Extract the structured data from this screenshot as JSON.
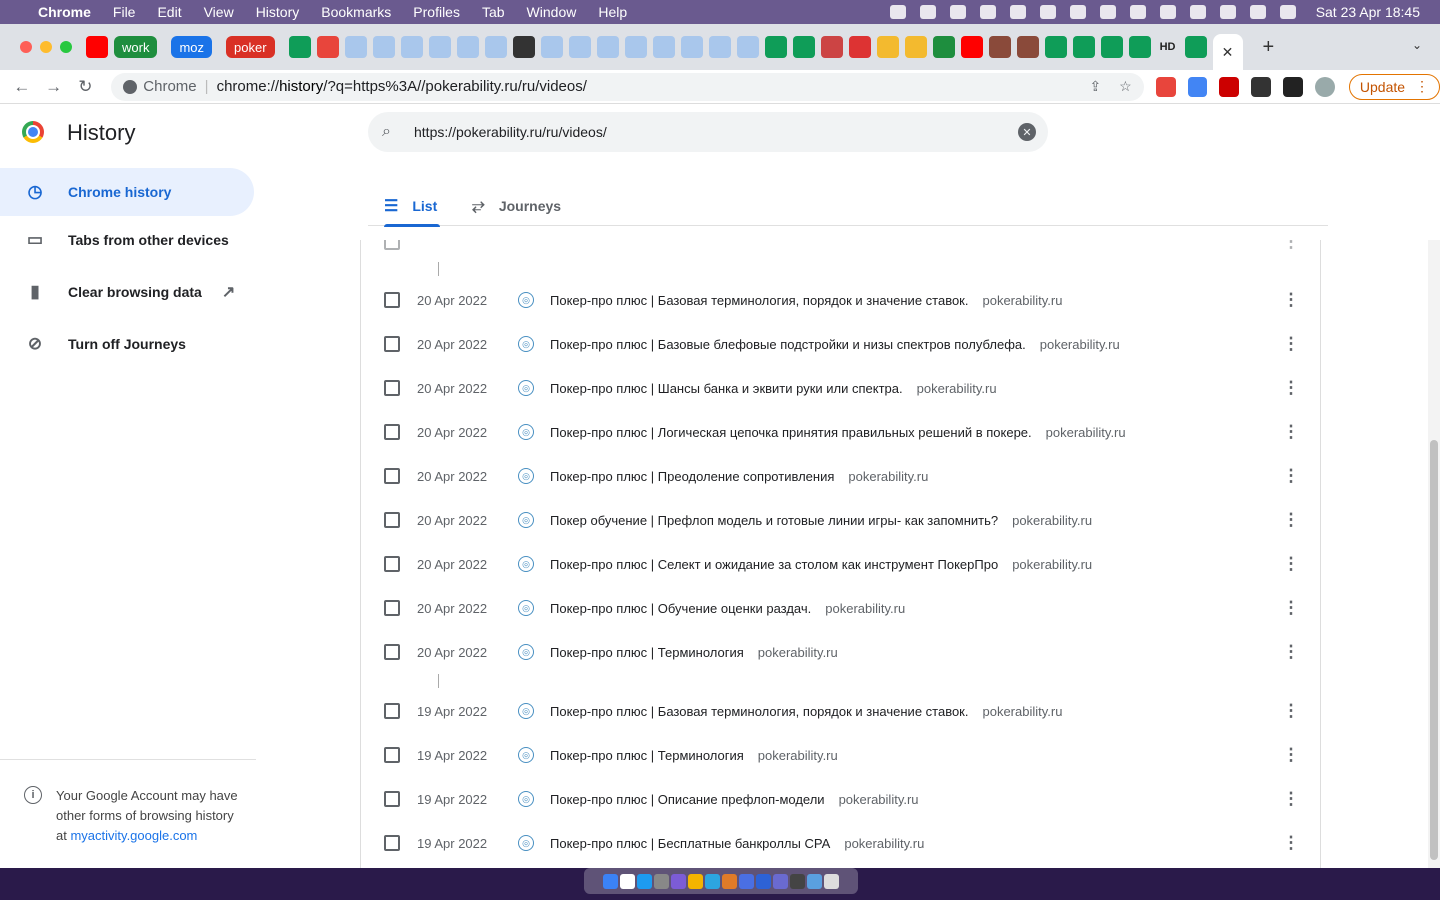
{
  "menubar": {
    "app": "Chrome",
    "items": [
      "File",
      "Edit",
      "View",
      "History",
      "Bookmarks",
      "Profiles",
      "Tab",
      "Window",
      "Help"
    ],
    "clock": "Sat 23 Apr  18:45"
  },
  "tabstrip": {
    "groups": [
      {
        "label": "work",
        "color": "#1e8e3e"
      },
      {
        "label": "moz",
        "color": "#1a73e8"
      },
      {
        "label": "poker",
        "color": "#d93025"
      }
    ],
    "hd_label": "HD",
    "close_glyph": "✕",
    "new_tab_glyph": "+",
    "dropdown_glyph": "⌄"
  },
  "toolbar": {
    "back_glyph": "←",
    "forward_glyph": "→",
    "reload_glyph": "↻",
    "omnibox_label": "Chrome",
    "url_prefix": "chrome://",
    "url_host": "history",
    "url_rest": "/?q=https%3A//pokerability.ru/ru/videos/",
    "update_label": "Update"
  },
  "sidebar": {
    "title": "History",
    "items": [
      {
        "label": "Chrome history",
        "icon": "clock-icon"
      },
      {
        "label": "Tabs from other devices",
        "icon": "devices-icon"
      },
      {
        "label": "Clear browsing data",
        "icon": "trash-icon"
      },
      {
        "label": "Turn off Journeys",
        "icon": "journeys-off-icon"
      }
    ],
    "footer_text": "Your Google Account may have other forms of browsing history at",
    "footer_link": "myactivity.google.com"
  },
  "search": {
    "value": "https://pokerability.ru/ru/videos/"
  },
  "view_tabs": {
    "list": "List",
    "journeys": "Journeys"
  },
  "history": {
    "rows": [
      {
        "date": "20 Apr 2022",
        "title": "Покер-про плюс | Базовая терминология, порядок и значение ставок.",
        "domain": "pokerability.ru"
      },
      {
        "date": "20 Apr 2022",
        "title": "Покер-про плюс | Базовые блефовые подстройки и низы спектров полублефа.",
        "domain": "pokerability.ru"
      },
      {
        "date": "20 Apr 2022",
        "title": "Покер-про плюс | Шансы банка и эквити руки или спектра.",
        "domain": "pokerability.ru"
      },
      {
        "date": "20 Apr 2022",
        "title": "Покер-про плюс | Логическая цепочка принятия правильных решений в покере.",
        "domain": "pokerability.ru"
      },
      {
        "date": "20 Apr 2022",
        "title": "Покер-про плюс | Преодоление сопротивления",
        "domain": "pokerability.ru"
      },
      {
        "date": "20 Apr 2022",
        "title": "Покер обучение | Префлоп модель и готовые линии игры- как запомнить?",
        "domain": "pokerability.ru"
      },
      {
        "date": "20 Apr 2022",
        "title": "Покер-про плюс | Селект и ожидание за столом как инструмент ПокерПро",
        "domain": "pokerability.ru"
      },
      {
        "date": "20 Apr 2022",
        "title": "Покер-про плюс | Обучение оценки раздач.",
        "domain": "pokerability.ru"
      },
      {
        "date": "20 Apr 2022",
        "title": "Покер-про плюс | Терминология",
        "domain": "pokerability.ru"
      },
      {
        "date": "19 Apr 2022",
        "title": "Покер-про плюс | Базовая терминология, порядок и значение ставок.",
        "domain": "pokerability.ru"
      },
      {
        "date": "19 Apr 2022",
        "title": "Покер-про плюс | Терминология",
        "domain": "pokerability.ru"
      },
      {
        "date": "19 Apr 2022",
        "title": "Покер-про плюс | Описание префлоп-модели",
        "domain": "pokerability.ru"
      },
      {
        "date": "19 Apr 2022",
        "title": "Покер-про плюс | Бесплатные банкроллы СРА",
        "domain": "pokerability.ru"
      }
    ]
  },
  "colors": {
    "accent": "#1967d2",
    "active_bg": "#e8f0fe",
    "update": "#e37400"
  }
}
